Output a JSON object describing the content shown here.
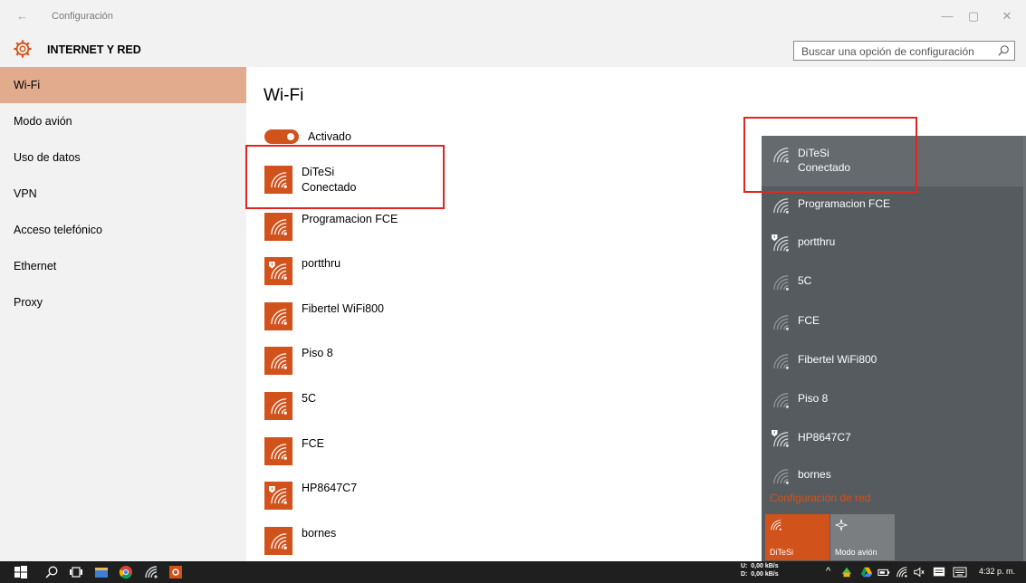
{
  "window": {
    "title": "Configuración",
    "back_glyph": "←",
    "minimize_glyph": "—",
    "restore_glyph": "▢",
    "close_glyph": "✕"
  },
  "header": {
    "title": "INTERNET Y RED",
    "icon": "gear-icon",
    "search_placeholder": "Buscar una opción de configuración"
  },
  "sidebar": {
    "items": [
      {
        "label": "Wi-Fi",
        "active": true
      },
      {
        "label": "Modo avión",
        "active": false
      },
      {
        "label": "Uso de datos",
        "active": false
      },
      {
        "label": "VPN",
        "active": false
      },
      {
        "label": "Acceso telefónico",
        "active": false
      },
      {
        "label": "Ethernet",
        "active": false
      },
      {
        "label": "Proxy",
        "active": false
      }
    ]
  },
  "main": {
    "title": "Wi-Fi",
    "toggle": {
      "label": "Activado",
      "state": "on"
    },
    "networks": [
      {
        "name": "DiTeSi",
        "status": "Conectado",
        "secured_warning": false
      },
      {
        "name": "Programacion FCE",
        "status": "",
        "secured_warning": false
      },
      {
        "name": "portthru",
        "status": "",
        "secured_warning": true
      },
      {
        "name": "Fibertel WiFi800",
        "status": "",
        "secured_warning": false
      },
      {
        "name": "Piso 8",
        "status": "",
        "secured_warning": false
      },
      {
        "name": "5C",
        "status": "",
        "secured_warning": false
      },
      {
        "name": "FCE",
        "status": "",
        "secured_warning": false
      },
      {
        "name": "HP8647C7",
        "status": "",
        "secured_warning": true
      },
      {
        "name": "bornes",
        "status": "",
        "secured_warning": false
      }
    ]
  },
  "flyout": {
    "networks": [
      {
        "name": "DiTeSi",
        "status": "Conectado",
        "secured_warning": false
      },
      {
        "name": "Programacion FCE",
        "status": "",
        "secured_warning": false
      },
      {
        "name": "portthru",
        "status": "",
        "secured_warning": true
      },
      {
        "name": "5C",
        "status": "",
        "secured_warning": false
      },
      {
        "name": "FCE",
        "status": "",
        "secured_warning": false
      },
      {
        "name": "Fibertel WiFi800",
        "status": "",
        "secured_warning": false
      },
      {
        "name": "Piso 8",
        "status": "",
        "secured_warning": false
      },
      {
        "name": "HP8647C7",
        "status": "",
        "secured_warning": true
      },
      {
        "name": "bornes",
        "status": "",
        "secured_warning": false
      }
    ],
    "settings_link": "Configuración de red",
    "quick_actions": [
      {
        "label": "DiTeSi",
        "active": true,
        "icon": "wifi-icon"
      },
      {
        "label": "Modo avión",
        "active": false,
        "icon": "airplane-icon"
      }
    ]
  },
  "taskbar": {
    "upload_label": "U:",
    "upload_speed": "0,00 kB/s",
    "download_label": "D:",
    "download_speed": "0,00 kB/s",
    "chevron_glyph": "^",
    "clock": "4:32 p. m."
  },
  "colors": {
    "accent": "#d2521c",
    "sidebar_active": "#e2ab8e",
    "panel_bg": "#f2f2f2",
    "flyout_bg": "#555b5f",
    "highlight_box": "#e2251f"
  }
}
